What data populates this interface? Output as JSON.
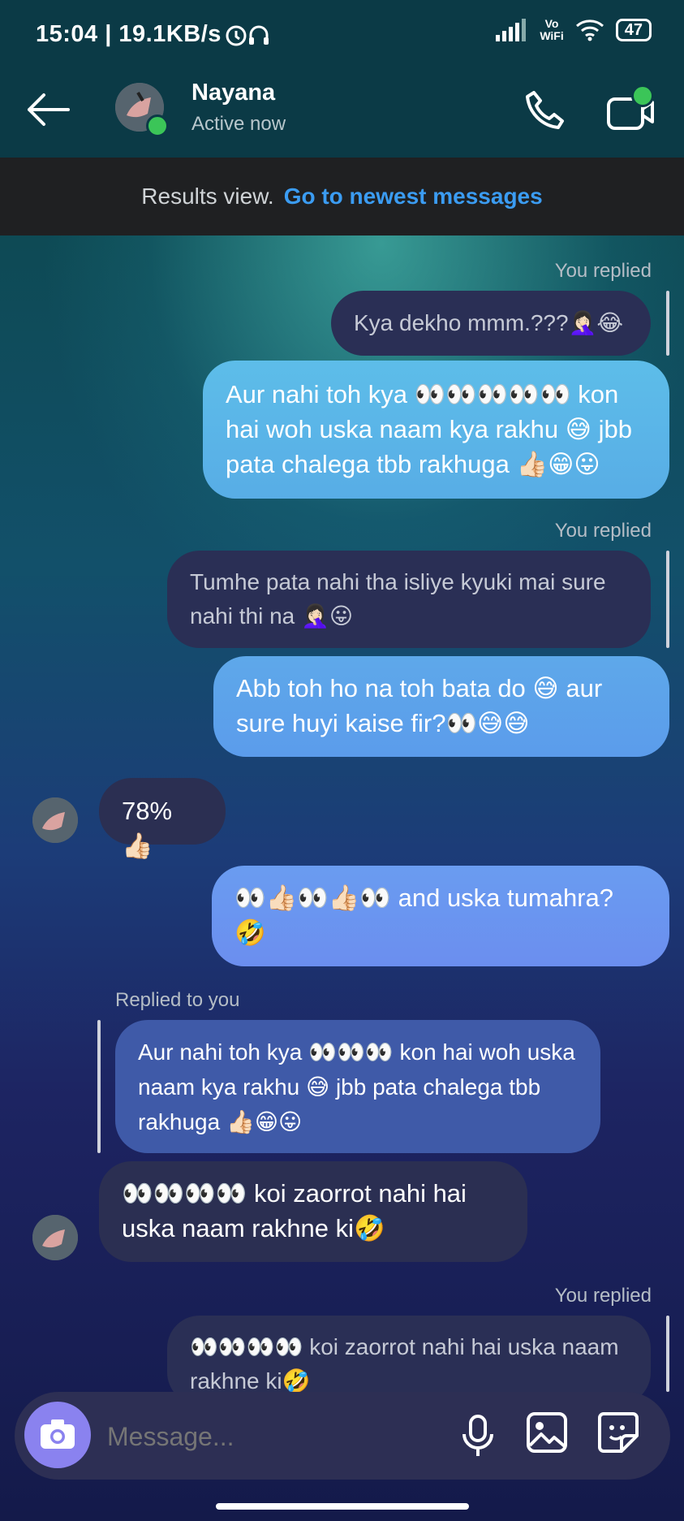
{
  "status_bar": {
    "time": "15:04 | 19.1KB/s",
    "vowifi_top": "Vo",
    "vowifi_bottom": "WiFi",
    "battery": "47"
  },
  "header": {
    "contact_name": "Nayana",
    "presence": "Active now"
  },
  "results_bar": {
    "label": "Results view.",
    "link": "Go to newest messages"
  },
  "messages": [
    {
      "meta": "You replied",
      "quoted": "Kya dekho mmm.???🤦🏻‍♀️😂",
      "text": "Aur nahi toh kya 👀👀👀👀👀 kon hai woh uska naam kya rakhu 😅 jbb pata chalega tbb rakhuga 👍🏻😁😛"
    },
    {
      "meta": "You replied",
      "quoted": "Tumhe pata nahi tha isliye kyuki mai sure nahi thi na 🤦🏻‍♀️😛",
      "text": "Abb toh ho na toh bata do 😅 aur sure huyi kaise fir?👀😅😅"
    },
    {
      "text": "78%👍🏻"
    },
    {
      "text": "👀👍🏻👀👍🏻👀 and uska tumahra? 🤣"
    },
    {
      "meta": "Replied to you",
      "quoted": "Aur nahi toh kya 👀👀👀 kon hai woh uska naam kya rakhu 😅 jbb pata chalega tbb rakhuga 👍🏻😁😛",
      "text": "👀👀👀👀 koi zaorrot nahi hai uska naam rakhne ki🤣"
    },
    {
      "meta": "You replied",
      "quoted": "👀👀👀👀 koi zaorrot nahi hai uska naam rakhne ki🤣"
    }
  ],
  "composer": {
    "placeholder": "Message..."
  },
  "icons": [
    "back-arrow-icon",
    "phone-icon",
    "video-call-icon",
    "camera-icon",
    "microphone-icon",
    "gallery-icon",
    "sticker-icon"
  ],
  "colors": {
    "link": "#3b9cf2",
    "online": "#3bc558",
    "sent_bubble_top": "#5bb6e6",
    "sent_bubble_bottom": "#6a8cf0",
    "received_bubble": "#2b2f52"
  }
}
